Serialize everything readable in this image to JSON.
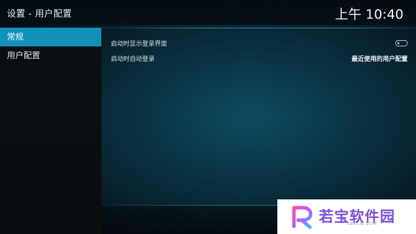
{
  "header": {
    "breadcrumb": "设置 - 用户配置",
    "clock": "上午 10:40"
  },
  "sidebar": {
    "items": [
      {
        "label": "常规",
        "active": true
      },
      {
        "label": "用户配置",
        "active": false
      }
    ]
  },
  "settings": {
    "rows": [
      {
        "label": "启动时显示登录界面",
        "type": "toggle",
        "toggle_on": false,
        "toggle_icon": "toggle-off-icon"
      },
      {
        "label": "启动时自动登录",
        "type": "value",
        "value": "最近使用的用户配置"
      }
    ]
  },
  "watermark": {
    "brand": "若宝软件园",
    "domain": "RBSCN.COM",
    "logo_icon": "r-logo-icon"
  },
  "colors": {
    "accent": "#1192b8",
    "watermark_text": "#7a4fd8"
  }
}
